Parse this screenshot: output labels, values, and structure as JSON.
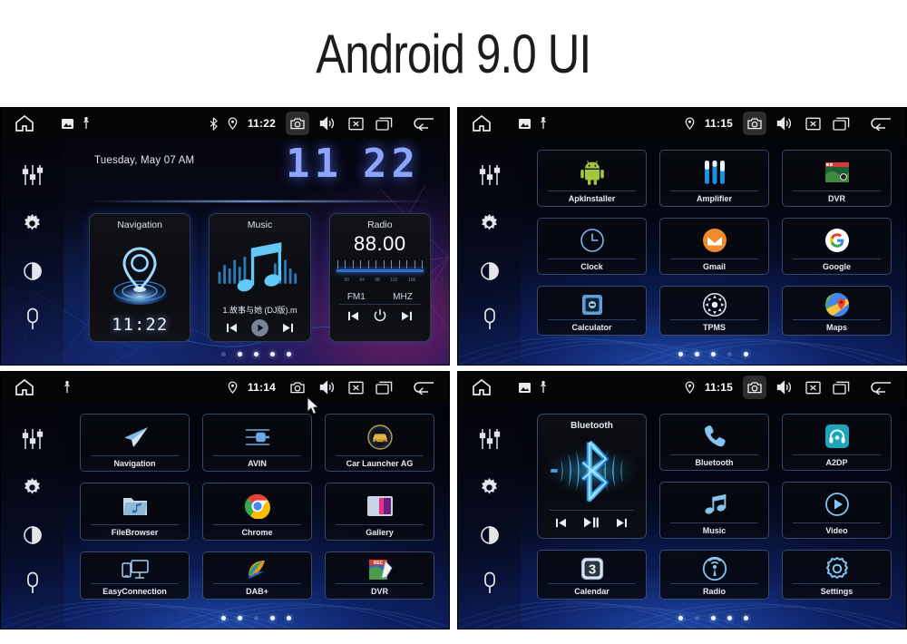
{
  "page": {
    "title": "Android 9.0 UI"
  },
  "colors": {
    "accent_blue": "#8fa4ff",
    "tile_border": "#6e96d7",
    "status_bg": "#050506",
    "panel1_bg": "#0a1338",
    "panel_bg": "#0a1c58"
  },
  "screens": [
    {
      "id": "home",
      "statusbar": {
        "home_icon": "home-icon",
        "left_icons": [
          "screenshot-icon",
          "usb-icon"
        ],
        "right_icons": [
          "bluetooth-icon",
          "location-icon"
        ],
        "show_bluetooth": true,
        "show_screenshot": true,
        "time": "11:22",
        "camera_icon": "camera-icon",
        "volume_icon": "volume-icon",
        "close_icon": "close-box-icon",
        "recents_icon": "recents-icon",
        "back_icon": "back-arrow-icon"
      },
      "rail": [
        {
          "name": "equalizer-icon",
          "label": "Equalizer"
        },
        {
          "name": "gear-icon",
          "label": "Settings"
        },
        {
          "name": "brightness-icon",
          "label": "Brightness"
        },
        {
          "name": "microphone-icon",
          "label": "Voice"
        }
      ],
      "home": {
        "date": "Tuesday, May 07  AM",
        "clock_hours": "11",
        "clock_minutes": "22",
        "widgets": {
          "navigation": {
            "title": "Navigation",
            "clock": "11:22"
          },
          "music": {
            "title": "Music",
            "track": "1.故事与她 (DJ版).m",
            "prev": "prev-track-button",
            "play": "play-button",
            "next": "next-track-button"
          },
          "radio": {
            "title": "Radio",
            "frequency": "88.00",
            "band": "FM1",
            "unit": "MHZ",
            "scale": [
              "90",
              "94",
              "98",
              "102",
              "106"
            ],
            "prev": "seek-down-button",
            "power": "power-button",
            "next": "seek-up-button"
          }
        }
      },
      "dots": {
        "count": 5,
        "active_index": 0
      }
    },
    {
      "id": "apps-page-1",
      "statusbar": {
        "show_bluetooth": false,
        "show_screenshot": true,
        "time": "11:15"
      },
      "apps": [
        {
          "label": "ApkInstaller",
          "icon": "android-robot-icon"
        },
        {
          "label": "Amplifier",
          "icon": "amplifier-sliders-icon"
        },
        {
          "label": "DVR",
          "icon": "dvr-camera-icon"
        },
        {
          "label": "Clock",
          "icon": "clock-icon"
        },
        {
          "label": "Gmail",
          "icon": "gmail-icon"
        },
        {
          "label": "Google",
          "icon": "google-g-icon"
        },
        {
          "label": "Calculator",
          "icon": "calculator-icon"
        },
        {
          "label": "TPMS",
          "icon": "tpms-wheel-icon"
        },
        {
          "label": "Maps",
          "icon": "google-maps-icon"
        }
      ],
      "dots": {
        "count": 5,
        "active_index": 3
      }
    },
    {
      "id": "apps-page-2",
      "statusbar": {
        "show_bluetooth": false,
        "show_screenshot": false,
        "time": "11:14",
        "cursor": true
      },
      "apps": [
        {
          "label": "Navigation",
          "icon": "paper-plane-icon"
        },
        {
          "label": "AVIN",
          "icon": "avin-plug-icon"
        },
        {
          "label": "Car Launcher AG",
          "icon": "car-launcher-icon"
        },
        {
          "label": "FileBrowser",
          "icon": "folder-music-icon"
        },
        {
          "label": "Chrome",
          "icon": "chrome-icon"
        },
        {
          "label": "Gallery",
          "icon": "gallery-icon"
        },
        {
          "label": "EasyConnection",
          "icon": "screen-mirror-icon"
        },
        {
          "label": "DAB+",
          "icon": "dab-plus-icon"
        },
        {
          "label": "DVR",
          "icon": "dvr-rec-icon"
        }
      ],
      "dots": {
        "count": 5,
        "active_index": 2
      }
    },
    {
      "id": "bluetooth-page",
      "statusbar": {
        "show_bluetooth": false,
        "show_screenshot": true,
        "time": "11:15"
      },
      "bt_widget": {
        "title": "Bluetooth",
        "icon": "bluetooth-wave-icon",
        "prev": "prev-track-button",
        "playpause": "play-pause-button",
        "next": "next-track-button"
      },
      "apps": [
        {
          "label": "Bluetooth",
          "icon": "phone-handset-icon"
        },
        {
          "label": "A2DP",
          "icon": "a2dp-headset-icon"
        },
        {
          "label": "Music",
          "icon": "music-note-icon"
        },
        {
          "label": "Video",
          "icon": "video-play-icon"
        },
        {
          "label": "Calendar",
          "icon": "calendar-icon"
        },
        {
          "label": "Radio",
          "icon": "radio-antenna-icon"
        },
        {
          "label": "Settings",
          "icon": "settings-gear-icon"
        }
      ],
      "dots": {
        "count": 5,
        "active_index": 1
      }
    }
  ]
}
